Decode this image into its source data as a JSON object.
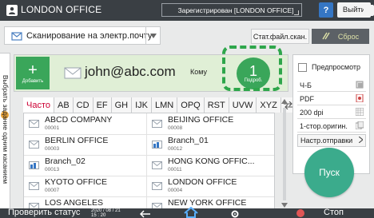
{
  "topbar": {
    "title": "LONDON OFFICE",
    "login_status": "Зарегистрирован [LONDON OFFICE]",
    "help_label": "?",
    "logout_label": "Выйти"
  },
  "mode": {
    "label": "Сканирование на электр.почту"
  },
  "buttons": {
    "scan_settings": "Стат.файл.скан.",
    "reset": "Сброс",
    "start": "Пуск"
  },
  "side_tab": {
    "label": "Выбрать задание одним касанием"
  },
  "destination": {
    "add_label": "Добавить",
    "email": "john@abc.com",
    "to_label": "Кому",
    "count": "1",
    "count_sub": "Подроб."
  },
  "tabs": [
    "Часто",
    "AB",
    "CD",
    "EF",
    "GH",
    "IJK",
    "LMN",
    "OPQ",
    "RST",
    "UVW",
    "XYZ"
  ],
  "active_tab": "Часто",
  "entries": [
    {
      "name": "ABCD COMPANY",
      "num": "00001",
      "type": "mail"
    },
    {
      "name": "BEIJING OFFICE",
      "num": "00008",
      "type": "mail"
    },
    {
      "name": "BERLIN OFFICE",
      "num": "00003",
      "type": "mail"
    },
    {
      "name": "Branch_01",
      "num": "00012",
      "type": "group"
    },
    {
      "name": "Branch_02",
      "num": "00013",
      "type": "group"
    },
    {
      "name": "HONG KONG OFFIC...",
      "num": "00011",
      "type": "mail"
    },
    {
      "name": "KYOTO OFFICE",
      "num": "00007",
      "type": "mail"
    },
    {
      "name": "LONDON OFFICE",
      "num": "00004",
      "type": "mail"
    },
    {
      "name": "LOS ANGELES",
      "num": "",
      "type": "mail"
    },
    {
      "name": "NEW YORK OFFICE",
      "num": "",
      "type": "mail"
    }
  ],
  "right_panel": {
    "preview_label": "Предпросмотр",
    "settings": [
      "Ч-Б",
      "PDF",
      "200 dpi",
      "1-стор.оригин."
    ],
    "send_settings": "Настр.отправки"
  },
  "bottombar": {
    "status_label": "Проверить статус",
    "date": "2020 / 08 / 21",
    "time": "15 : 20",
    "stop_label": "Стоп"
  },
  "colors": {
    "accent_green": "#3aa65a",
    "start_teal": "#3bab8c",
    "dash_green": "#2ea64b",
    "topbar": "#3a3f44",
    "active_tab_red": "#cc0033"
  }
}
